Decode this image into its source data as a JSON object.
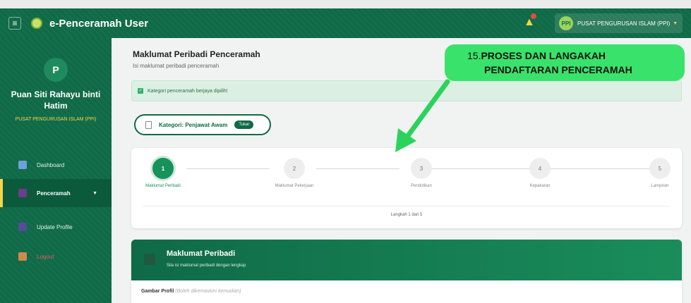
{
  "topbar": {
    "app_title": "e-Penceramah User",
    "user_initials": "PPI",
    "user_org": "PUSAT PENGURUSAN ISLAM (PPI)",
    "menu_icon": "menu-icon",
    "bell_icon": "bell-icon",
    "accent": "#0f6a47"
  },
  "sidebar": {
    "avatar_initial": "P",
    "user_name_line1": "Puan Siti Rahayu binti",
    "user_name_line2": "Hatim",
    "user_org": "PUSAT PENGURUSAN ISLAM (PPI)",
    "items": [
      {
        "label": "Dashboard",
        "icon": "dashboard-icon"
      },
      {
        "label": "Penceramah",
        "icon": "users-icon",
        "active": true
      },
      {
        "label": "Update Profile",
        "icon": "user-icon"
      },
      {
        "label": "Logout",
        "icon": "logout-icon"
      }
    ]
  },
  "main": {
    "title": "Maklumat Peribadi Penceramah",
    "subtitle": "Isi maklumat peribadi penceramah",
    "alert": "Kategori penceramah berjaya dipilih!",
    "category_label": "Kategori: Penjawat Awam",
    "change_button": "Tukar",
    "steps": [
      {
        "num": "1",
        "label": "Maklumat Peribadi",
        "active": true
      },
      {
        "num": "2",
        "label": "Maklumat Pekerjaan"
      },
      {
        "num": "3",
        "label": "Pendidikan"
      },
      {
        "num": "4",
        "label": "Kepakaran"
      },
      {
        "num": "5",
        "label": "Lampiran"
      }
    ],
    "step_count": "Langkah 1 dari 5",
    "section_title": "Maklumat Peribadi",
    "section_subtitle": "Sila isi maklumat peribadi dengan lengkap",
    "field_label": "Gambar Profil",
    "field_hint": "(Boleh dikemaskini kemudian)"
  },
  "callout": {
    "number": "15.",
    "line1": "PROSES DAN LANGAKAH",
    "line2": "PENDAFTARAN PENCERAMAH",
    "color": "#39e36b"
  }
}
